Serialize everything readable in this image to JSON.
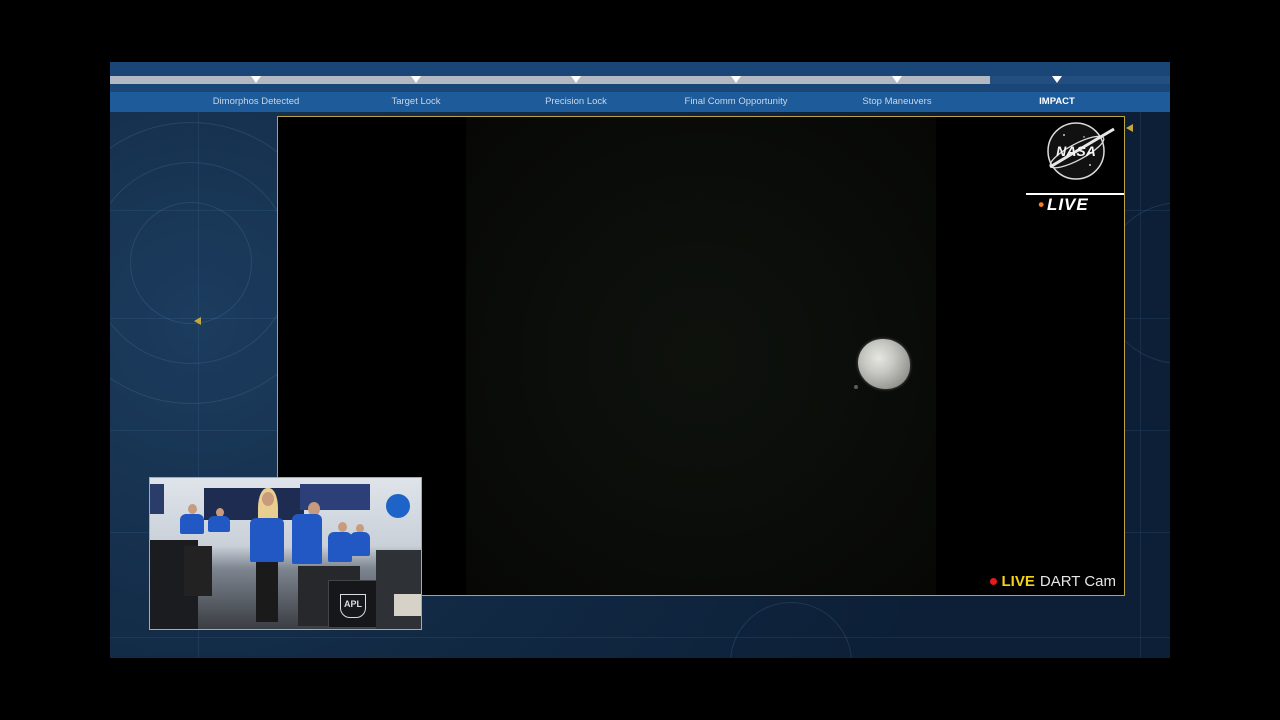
{
  "timeline": {
    "progress": 0.83,
    "milestones": [
      {
        "label": "Dimorphos Detected"
      },
      {
        "label": "Target Lock"
      },
      {
        "label": "Precision Lock"
      },
      {
        "label": "Final Comm Opportunity"
      },
      {
        "label": "Stop Maneuvers"
      },
      {
        "label": "IMPACT"
      }
    ]
  },
  "broadcast": {
    "logo": "NASA",
    "live_badge": "LIVE",
    "camera_live": "LIVE",
    "camera_name": "DART Cam"
  },
  "pip": {
    "logo_text": "APL"
  },
  "colors": {
    "accent_gold": "#c7ad48",
    "live_yellow": "#f2d21b",
    "live_orange": "#ff7a1a",
    "rec_red": "#e21b1b",
    "panel_blue": "#1d5b9a"
  }
}
